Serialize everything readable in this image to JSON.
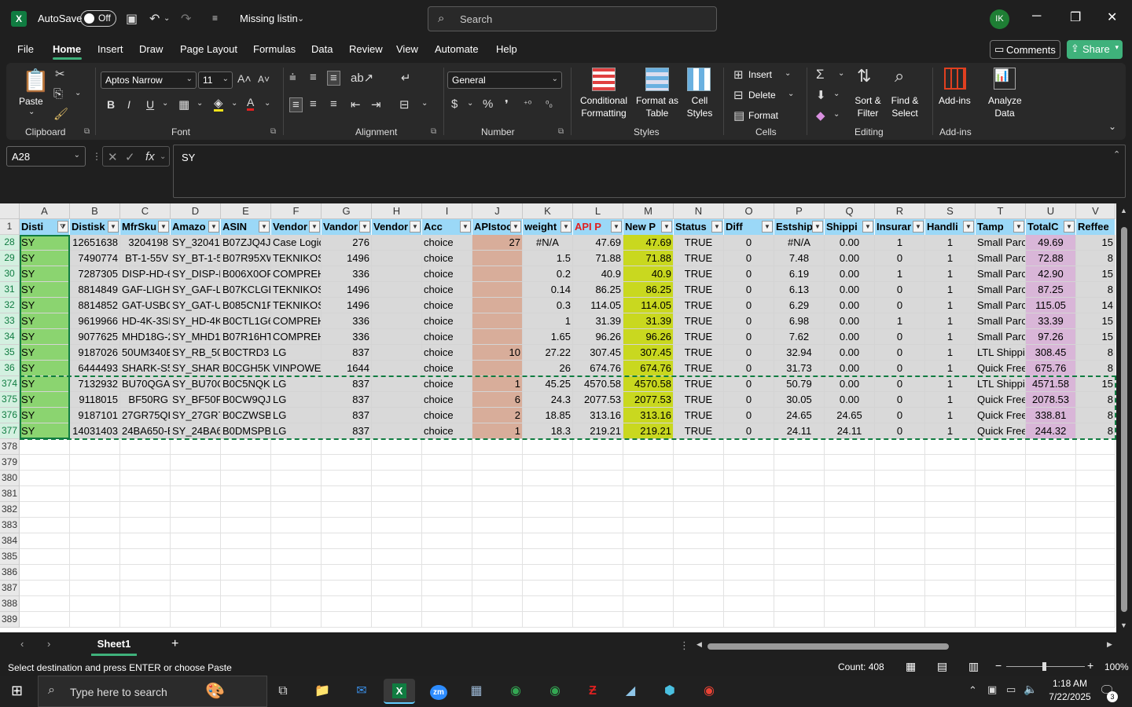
{
  "titlebar": {
    "autosave_label": "AutoSave",
    "autosave_state": "Off",
    "doc_title": "Missing listin",
    "search_placeholder": "Search",
    "user_initials": "IK"
  },
  "menu": {
    "items": [
      "File",
      "Home",
      "Insert",
      "Draw",
      "Page Layout",
      "Formulas",
      "Data",
      "Review",
      "View",
      "Automate",
      "Help"
    ],
    "comments": "Comments",
    "share": "Share"
  },
  "ribbon": {
    "clipboard": {
      "paste": "Paste",
      "label": "Clipboard"
    },
    "font": {
      "name": "Aptos Narrow",
      "size": "11",
      "label": "Font"
    },
    "alignment": {
      "label": "Alignment"
    },
    "number": {
      "format": "General",
      "label": "Number"
    },
    "styles": {
      "conditional": "Conditional\nFormatting",
      "format_table": "Format as\nTable",
      "cell_styles": "Cell\nStyles",
      "label": "Styles"
    },
    "cells": {
      "insert": "Insert",
      "delete": "Delete",
      "format": "Format",
      "label": "Cells"
    },
    "editing": {
      "sort": "Sort &\nFilter",
      "find": "Find &\nSelect",
      "label": "Editing"
    },
    "addins": {
      "addins": "Add-ins",
      "analyze": "Analyze\nData",
      "label": "Add-ins"
    }
  },
  "formula": {
    "namebox": "A28",
    "value": "SY"
  },
  "columns": [
    "A",
    "B",
    "C",
    "D",
    "E",
    "F",
    "G",
    "H",
    "I",
    "J",
    "K",
    "L",
    "M",
    "N",
    "O",
    "P",
    "Q",
    "R",
    "S",
    "T",
    "U",
    "V"
  ],
  "headers": [
    "Disti",
    "Distisk",
    "MfrSku",
    "Amazo",
    "ASIN",
    "Vendor",
    "Vandor",
    "Vendor",
    "Acc",
    "APIstoc",
    "weight",
    "API P",
    "New P",
    "Status",
    "Diff",
    "Estship",
    "Shippi",
    "Insurar",
    "Handli",
    "Tamp",
    "TotalC",
    "Reffee"
  ],
  "rows": [
    {
      "n": "28",
      "v": [
        "SY",
        "12651638",
        "3204198",
        "SY_320419",
        "B07ZJQ4J6",
        "Case Logic",
        "276",
        "",
        "choice",
        "27",
        "#N/A",
        "47.69",
        "47.69",
        "TRUE",
        "0",
        "#N/A",
        "0.00",
        "1",
        "1",
        "Small Parc",
        "49.69",
        "15"
      ]
    },
    {
      "n": "29",
      "v": [
        "SY",
        "7490774",
        "BT-1-55V",
        "SY_BT-1-5",
        "B07R95XW",
        "TEKNIKOS",
        "1496",
        "",
        "choice",
        "",
        "1.5",
        "71.88",
        "71.88",
        "TRUE",
        "0",
        "7.48",
        "0.00",
        "0",
        "1",
        "Small Parc",
        "72.88",
        "8"
      ]
    },
    {
      "n": "30",
      "v": [
        "SY",
        "7287305",
        "DISP-HD-6",
        "SY_DISP-H",
        "B006X0OF",
        "COMPREH",
        "336",
        "",
        "choice",
        "",
        "0.2",
        "40.9",
        "40.9",
        "TRUE",
        "0",
        "6.19",
        "0.00",
        "1",
        "1",
        "Small Parc",
        "42.90",
        "15"
      ]
    },
    {
      "n": "31",
      "v": [
        "SY",
        "8814849",
        "GAF-LIGHT",
        "SY_GAF-LI",
        "B07KCLGB",
        "TEKNIKOS",
        "1496",
        "",
        "choice",
        "",
        "0.14",
        "86.25",
        "86.25",
        "TRUE",
        "0",
        "6.13",
        "0.00",
        "0",
        "1",
        "Small Parc",
        "87.25",
        "8"
      ]
    },
    {
      "n": "32",
      "v": [
        "SY",
        "8814852",
        "GAT-USBC",
        "SY_GAT-US",
        "B085CN1R",
        "TEKNIKOS",
        "1496",
        "",
        "choice",
        "",
        "0.3",
        "114.05",
        "114.05",
        "TRUE",
        "0",
        "6.29",
        "0.00",
        "0",
        "1",
        "Small Parc",
        "115.05",
        "14"
      ]
    },
    {
      "n": "33",
      "v": [
        "SY",
        "9619966",
        "HD-4K-3SF",
        "SY_HD-4K",
        "B0CTL1G6",
        "COMPREH",
        "336",
        "",
        "choice",
        "",
        "1",
        "31.39",
        "31.39",
        "TRUE",
        "0",
        "6.98",
        "0.00",
        "1",
        "1",
        "Small Parc",
        "33.39",
        "15"
      ]
    },
    {
      "n": "34",
      "v": [
        "SY",
        "9077625",
        "MHD18G-2",
        "SY_MHD18",
        "B07R16HT",
        "COMPREH",
        "336",
        "",
        "choice",
        "",
        "1.65",
        "96.26",
        "96.26",
        "TRUE",
        "0",
        "7.62",
        "0.00",
        "0",
        "1",
        "Small Parc",
        "97.26",
        "15"
      ]
    },
    {
      "n": "35",
      "v": [
        "SY",
        "9187026",
        "50UM340E",
        "SY_RB_50U",
        "B0CTRD3",
        "LG",
        "837",
        "",
        "choice",
        "10",
        "27.22",
        "307.45",
        "307.45",
        "TRUE",
        "0",
        "32.94",
        "0.00",
        "0",
        "1",
        "LTL Shippi",
        "308.45",
        "8"
      ]
    },
    {
      "n": "36",
      "v": [
        "SY",
        "6444493",
        "SHARK-S5",
        "SY_SHARK",
        "B0CGH5KL",
        "VINPOWEI",
        "1644",
        "",
        "choice",
        "",
        "26",
        "674.76",
        "674.76",
        "TRUE",
        "0",
        "31.73",
        "0.00",
        "0",
        "1",
        "Quick Free",
        "675.76",
        "8"
      ]
    },
    {
      "n": "374",
      "v": [
        "SY",
        "7132932",
        "BU70QGA",
        "SY_BU70Q",
        "B0C5NQKI",
        "LG",
        "837",
        "",
        "choice",
        "1",
        "45.25",
        "4570.58",
        "4570.58",
        "TRUE",
        "0",
        "50.79",
        "0.00",
        "0",
        "1",
        "LTL Shippi",
        "4571.58",
        "15"
      ]
    },
    {
      "n": "375",
      "v": [
        "SY",
        "9118015",
        "BF50RG",
        "SY_BF50RG",
        "B0CW9QJ6",
        "LG",
        "837",
        "",
        "choice",
        "6",
        "24.3",
        "2077.53",
        "2077.53",
        "TRUE",
        "0",
        "30.05",
        "0.00",
        "0",
        "1",
        "Quick Free",
        "2078.53",
        "8"
      ]
    },
    {
      "n": "376",
      "v": [
        "SY",
        "9187101",
        "27GR75QE",
        "SY_27GR75",
        "B0CZWSB1",
        "LG",
        "837",
        "",
        "choice",
        "2",
        "18.85",
        "313.16",
        "313.16",
        "TRUE",
        "0",
        "24.65",
        "24.65",
        "0",
        "1",
        "Quick Free",
        "338.81",
        "8"
      ]
    },
    {
      "n": "377",
      "v": [
        "SY",
        "14031403",
        "24BA650-E",
        "SY_24BA65",
        "B0DMSPBV",
        "LG",
        "837",
        "",
        "choice",
        "1",
        "18.3",
        "219.21",
        "219.21",
        "TRUE",
        "0",
        "24.11",
        "24.11",
        "0",
        "1",
        "Quick Free",
        "244.32",
        "8"
      ]
    }
  ],
  "empty_rows": [
    "378",
    "379",
    "380",
    "381",
    "382",
    "383",
    "384",
    "385",
    "386",
    "387",
    "388",
    "389"
  ],
  "sheet": {
    "name": "Sheet1",
    "add": "+"
  },
  "status": {
    "message": "Select destination and press ENTER or choose Paste",
    "count": "Count: 408",
    "zoom": "100%"
  },
  "taskbar": {
    "search_placeholder": "Type here to search",
    "time": "1:18 AM",
    "date": "7/22/2025",
    "notifications": "3"
  },
  "colors": {
    "accent": "#3fb17b",
    "header_blue": "#9bd8f7",
    "green_col": "#8bd470",
    "olive_col": "#c9d81f",
    "tan_col": "#d8ad9a",
    "pink_col": "#d9b6d8",
    "grey_cell": "#d9d9d9"
  }
}
